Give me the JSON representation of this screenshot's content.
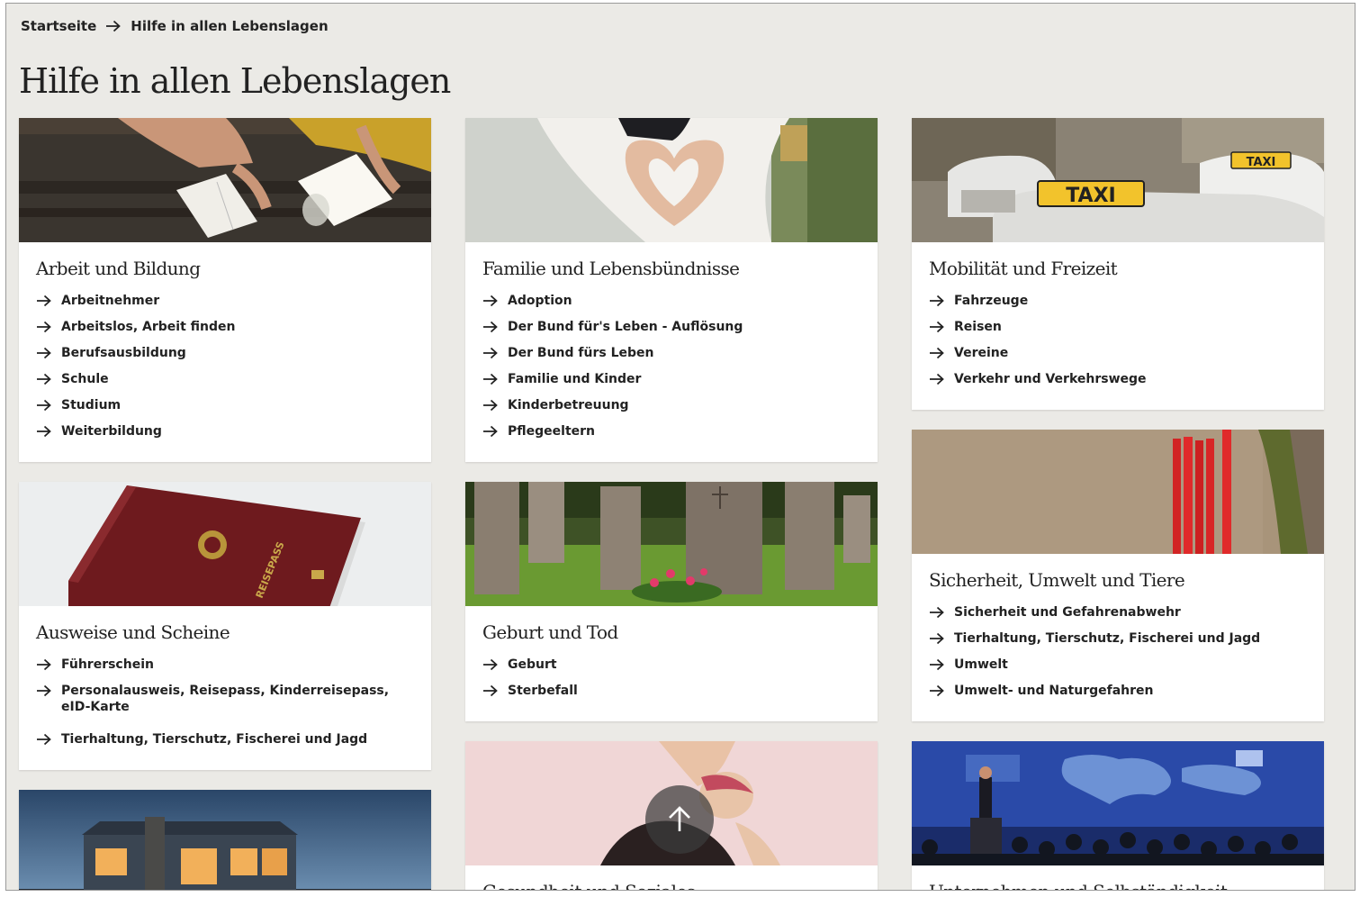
{
  "breadcrumb": {
    "home": "Startseite",
    "current": "Hilfe in allen Lebenslagen"
  },
  "page_title": "Hilfe in allen Lebenslagen",
  "colors": {
    "background": "#ebeae6",
    "card": "#ffffff",
    "text": "#222222"
  },
  "cards": {
    "arbeit": {
      "title": "Arbeit und Bildung",
      "image": "students-writing-photo",
      "links": [
        "Arbeitnehmer",
        "Arbeitslos, Arbeit finden",
        "Berufsausbildung",
        "Schule",
        "Studium",
        "Weiterbildung"
      ]
    },
    "ausweise": {
      "title": "Ausweise und Scheine",
      "image": "passport-photo",
      "links": [
        "Führerschein",
        "Personalausweis, Reisepass, Kinderreisepass, eID-Karte",
        "Tierhaltung, Tierschutz, Fischerei und Jagd"
      ]
    },
    "bauen": {
      "image": "house-at-dusk-photo"
    },
    "familie": {
      "title": "Familie und Lebensbündnisse",
      "image": "heart-hands-photo",
      "links": [
        "Adoption",
        "Der Bund für's Leben - Auflösung",
        "Der Bund fürs Leben",
        "Familie und Kinder",
        "Kinderbetreuung",
        "Pflegeeltern"
      ]
    },
    "geburt": {
      "title": "Geburt und Tod",
      "image": "cemetery-photo",
      "links": [
        "Geburt",
        "Sterbefall"
      ]
    },
    "gesundheit": {
      "title": "Gesundheit und Soziales",
      "image": "stretching-woman-photo"
    },
    "mobilitaet": {
      "title": "Mobilität und Freizeit",
      "image": "taxi-photo",
      "links": [
        "Fahrzeuge",
        "Reisen",
        "Vereine",
        "Verkehr und Verkehrswege"
      ]
    },
    "sicherheit": {
      "title": "Sicherheit, Umwelt und Tiere",
      "image": "red-posts-photo",
      "links": [
        "Sicherheit und Gefahrenabwehr",
        "Tierhaltung, Tierschutz, Fischerei und Jagd",
        "Umwelt",
        "Umwelt- und Naturgefahren"
      ]
    },
    "unternehmen": {
      "title": "Unternehmen und Selbständigkeit",
      "image": "conference-photo"
    }
  },
  "scroll_top_icon": "arrow-up-icon"
}
